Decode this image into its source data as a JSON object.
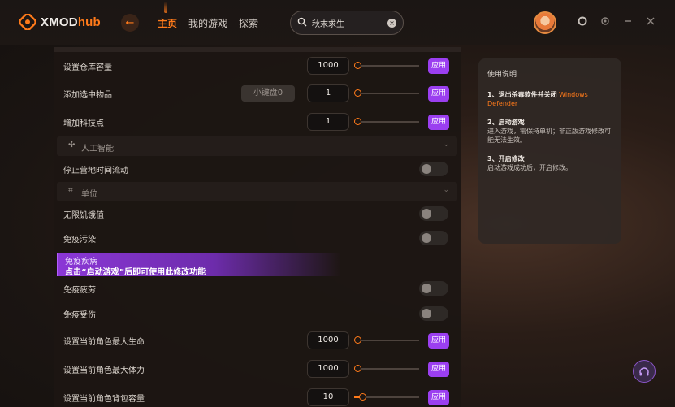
{
  "app": {
    "logo_text_a": "XMOD",
    "logo_text_b": "hub",
    "nav": [
      "主页",
      "我的游戏",
      "探索"
    ],
    "search_value": "秋末求生"
  },
  "rows": {
    "r1_label": "设置仓库容量",
    "r1_value": "1000",
    "r1_apply": "应用",
    "r2_label": "添加选中物品",
    "r2_key": "小键盘0",
    "r2_value": "1",
    "r2_apply": "应用",
    "r3_label": "增加科技点",
    "r3_value": "1",
    "r3_apply": "应用",
    "sec_ai": "人工智能",
    "r4_label": "停止营地时间流动",
    "sec_unit": "单位",
    "r5_label": "无限饥饿值",
    "r6_label": "免疫污染",
    "tooltip_line1": "免疫疾病",
    "tooltip_line2": "点击“启动游戏”后即可使用此修改功能",
    "r7_label": "免疫疲劳",
    "r8_label": "免疫受伤",
    "r9_label": "设置当前角色最大生命",
    "r9_value": "1000",
    "r9_apply": "应用",
    "r10_label": "设置当前角色最大体力",
    "r10_value": "1000",
    "r10_apply": "应用",
    "r11_label": "设置当前角色背包容量",
    "r11_value": "10",
    "r11_apply": "应用"
  },
  "help": {
    "title": "使用说明",
    "s1_head": "1、退出杀毒软件并关闭",
    "s1_orange": "Windows Defender",
    "s2_head": "2、启动游戏",
    "s2_body": "进入游戏，需保持单机；非正版游戏修改可能无法生效。",
    "s3_head": "3、开启修改",
    "s3_body": "启动游戏成功后，开启修改。"
  },
  "colors": {
    "accent": "#ff7a1a",
    "apply_button": "#9b3ff0"
  },
  "icons": {
    "logo": "xmod-logo-icon",
    "back": "back-arrow-icon",
    "search": "search-icon",
    "clear": "clear-icon",
    "ai_section": "ai-icon",
    "unit_section": "unit-icon",
    "support": "headset-icon"
  }
}
